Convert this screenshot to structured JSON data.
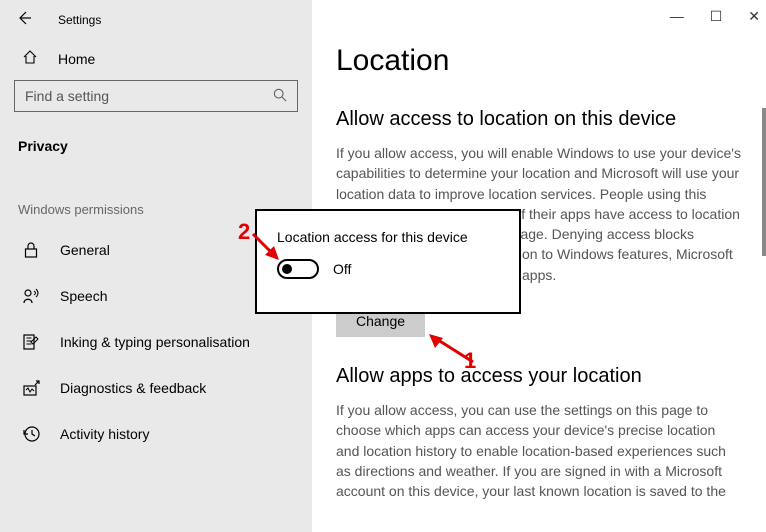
{
  "app": {
    "title": "Settings"
  },
  "win_controls": {
    "min": "—",
    "max": "☐",
    "close": "✕"
  },
  "sidebar": {
    "home_label": "Home",
    "search_placeholder": "Find a setting",
    "active_section": "Privacy",
    "group_title": "Windows permissions",
    "items": [
      {
        "icon": "lock",
        "label": "General"
      },
      {
        "icon": "speech",
        "label": "Speech"
      },
      {
        "icon": "inking",
        "label": "Inking & typing personalisation"
      },
      {
        "icon": "diagnostics",
        "label": "Diagnostics & feedback"
      },
      {
        "icon": "history",
        "label": "Activity history"
      }
    ]
  },
  "main": {
    "title": "Location",
    "section1_heading": "Allow access to location on this device",
    "section1_body": "If you allow access, you will enable Windows to use your device's capabilities to determine your location and Microsoft will use your location data to improve location services. People using this device will be able to choose if their apps have access to location by using the settings on this page. Denying access blocks Windows from providing location to Windows features, Microsoft Store apps and most desktop apps.",
    "change_button": "Change",
    "section2_heading": "Allow apps to access your location",
    "section2_body": "If you allow access, you can use the settings on this page to choose which apps can access your device's precise location and location history to enable location-based experiences such as directions and weather. If you are signed in with a Microsoft account on this device, your last known location is saved to the"
  },
  "popup": {
    "title": "Location access for this device",
    "toggle_state": "Off"
  },
  "annotations": {
    "one": "1",
    "two": "2"
  }
}
